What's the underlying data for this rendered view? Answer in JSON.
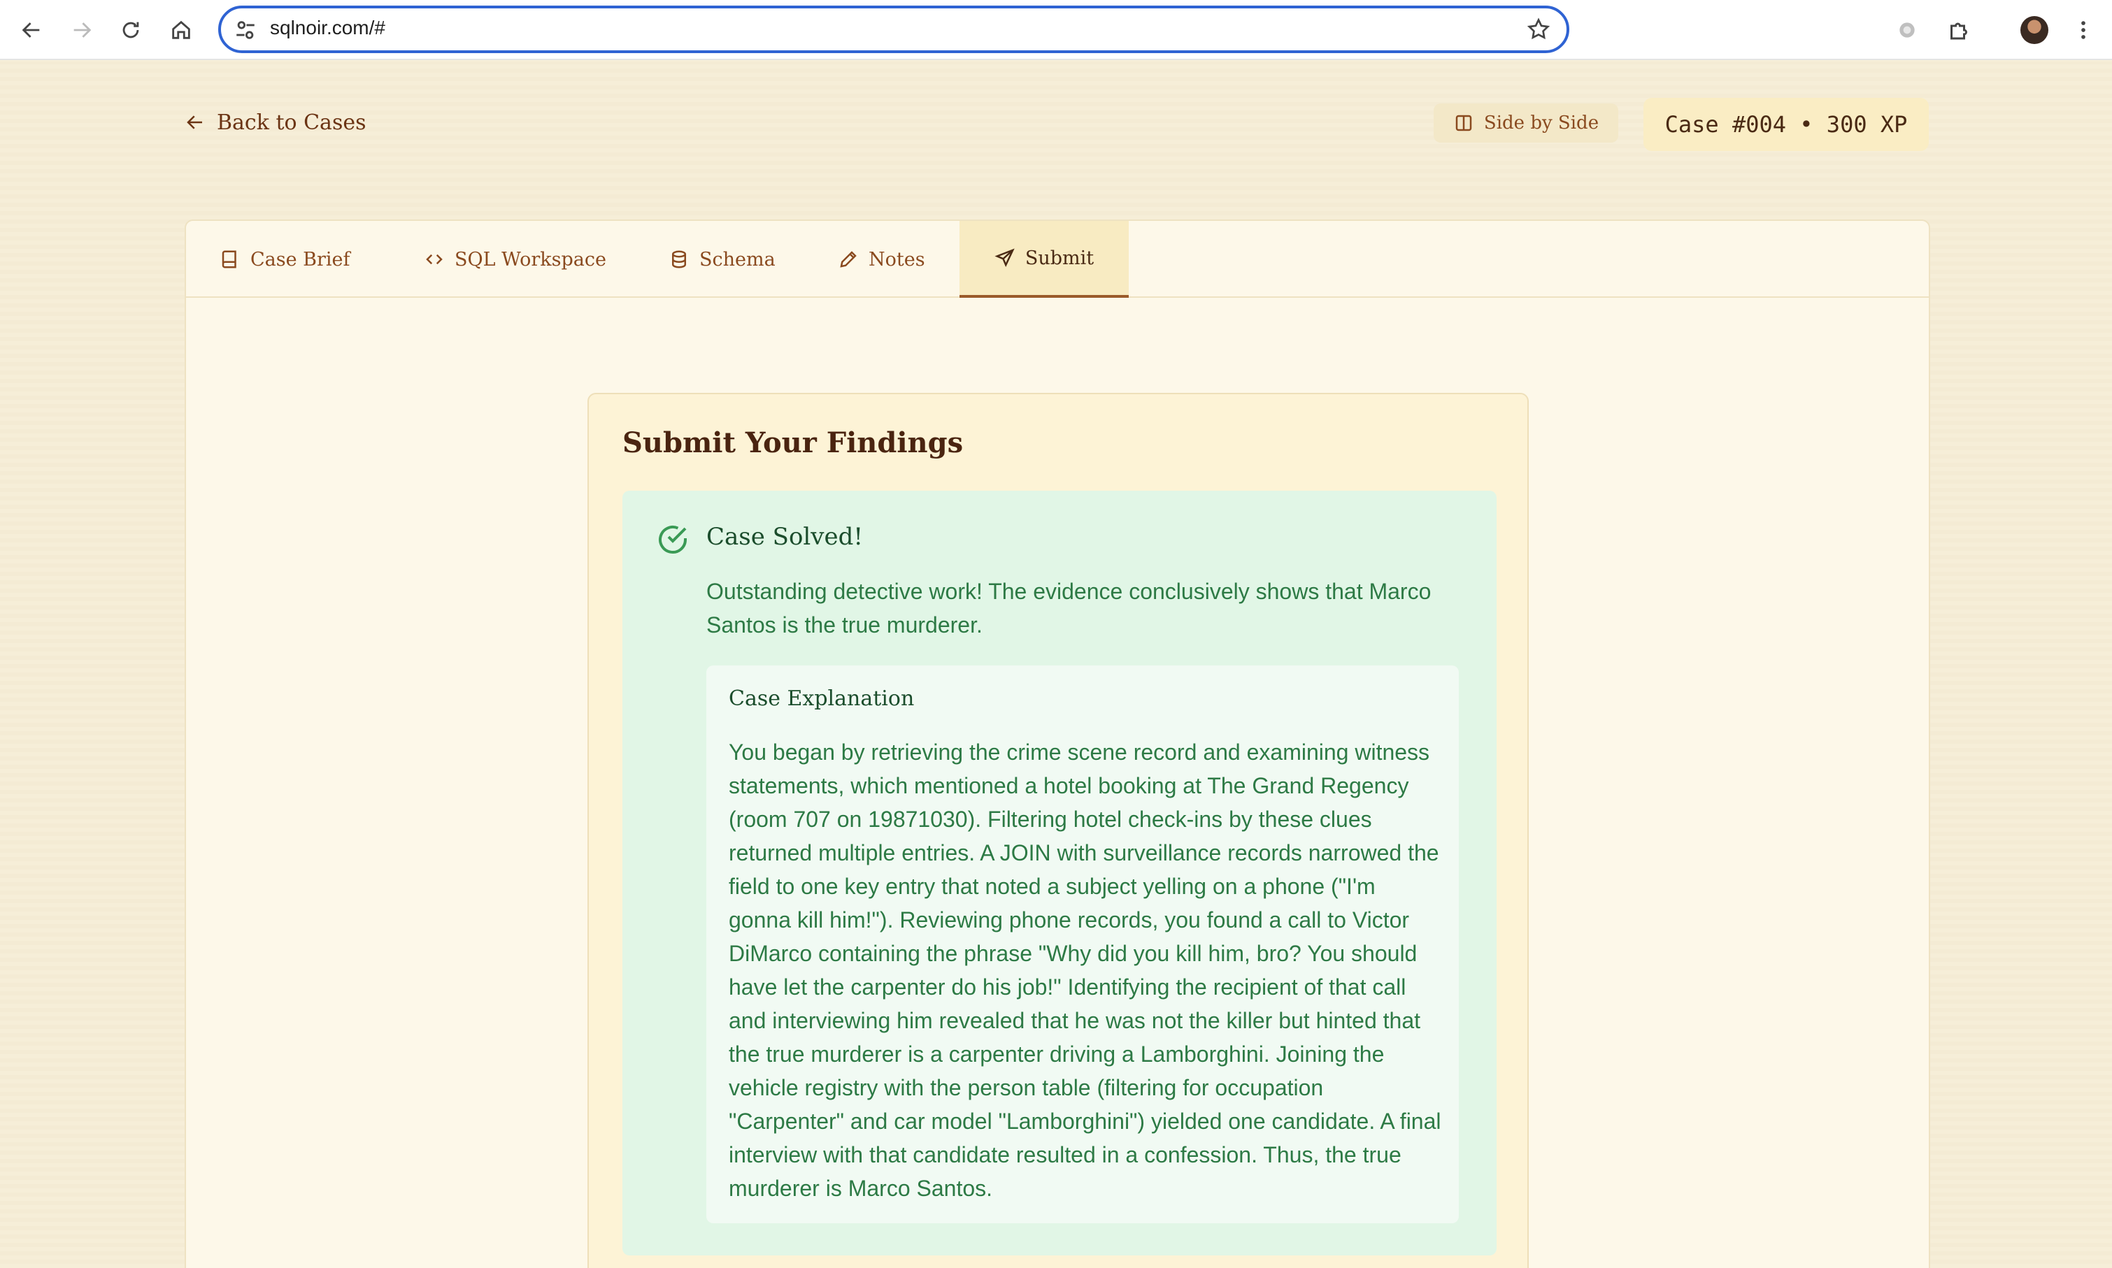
{
  "browser": {
    "url": "sqlnoir.com/#"
  },
  "header": {
    "back_label": "Back to Cases",
    "side_by_side_label": "Side by Side",
    "case_badge": "Case #004 • 300 XP"
  },
  "tabs": [
    {
      "label": "Case Brief",
      "icon": "book-icon"
    },
    {
      "label": "SQL Workspace",
      "icon": "code-icon"
    },
    {
      "label": "Schema",
      "icon": "database-icon"
    },
    {
      "label": "Notes",
      "icon": "pencil-icon"
    },
    {
      "label": "Submit",
      "icon": "send-icon",
      "active": true
    }
  ],
  "submit": {
    "title": "Submit Your Findings",
    "result_title": "Case Solved!",
    "result_message": "Outstanding detective work! The evidence conclusively shows that Marco Santos is the true murderer.",
    "explanation_title": "Case Explanation",
    "explanation_body": "You began by retrieving the crime scene record and examining witness statements, which mentioned a hotel booking at The Grand Regency (room 707 on 19871030). Filtering hotel check-ins by these clues returned multiple entries. A JOIN with surveillance records narrowed the field to one key entry that noted a subject yelling on a phone (\"I'm gonna kill him!\"). Reviewing phone records, you found a call to Victor DiMarco containing the phrase \"Why did you kill him, bro? You should have let the carpenter do his job!\" Identifying the recipient of that call and interviewing him revealed that he was not the killer but hinted that the true murderer is a carpenter driving a Lamborghini. Joining the vehicle registry with the person table (filtering for occupation \"Carpenter\" and car model \"Lamborghini\") yielded one candidate. A final interview with that candidate resulted in a confession. Thus, the true murderer is Marco Santos."
  },
  "colors": {
    "accent": "#8a4a1f",
    "success_bg": "#e1f6e6",
    "success_text": "#2d7a45",
    "omnibox_focus": "#2f63d3"
  }
}
